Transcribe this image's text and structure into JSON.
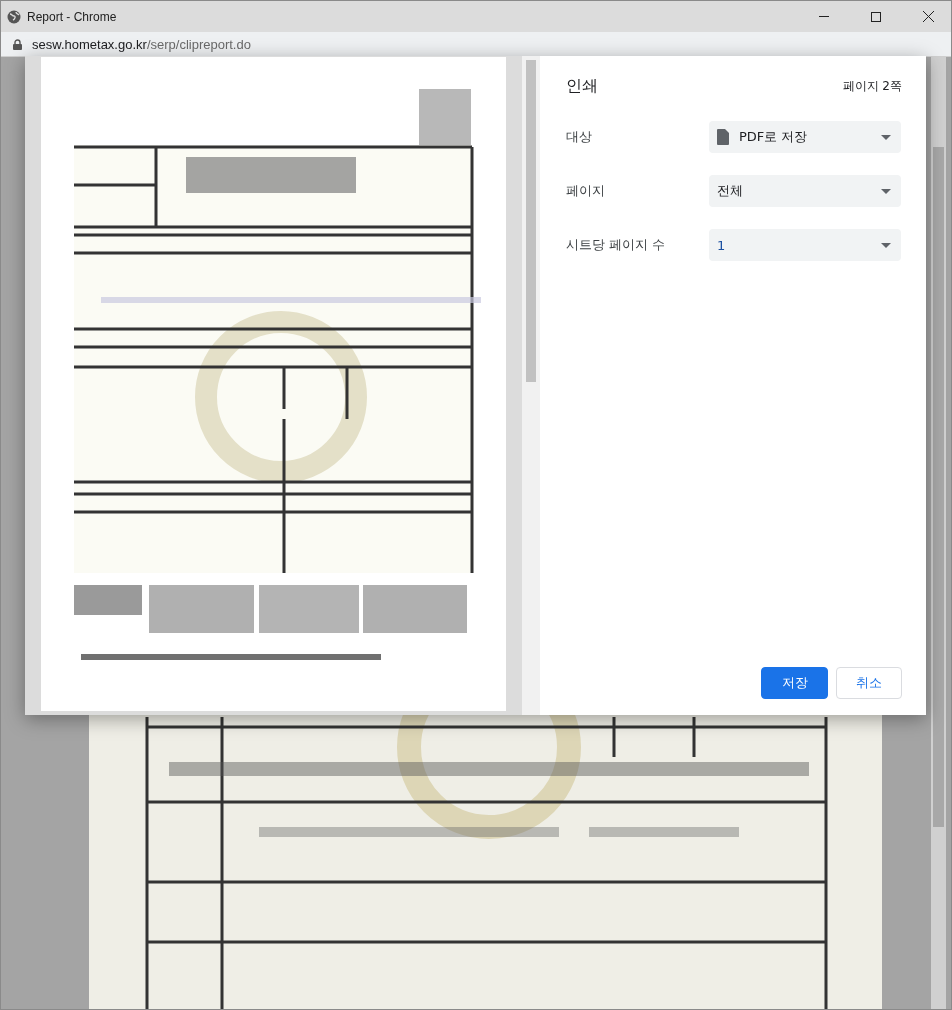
{
  "window": {
    "title": "Report - Chrome"
  },
  "address_bar": {
    "host": "sesw.hometax.go.kr",
    "path": "/serp/clipreport.do"
  },
  "print_dialog": {
    "title": "인쇄",
    "page_count": "페이지 2쪽",
    "settings": [
      {
        "label": "대상",
        "value": "PDF로 저장",
        "kind": "destination"
      },
      {
        "label": "페이지",
        "value": "전체",
        "kind": "select"
      },
      {
        "label": "시트당 페이지 수",
        "value": "1",
        "kind": "select"
      }
    ],
    "buttons": [
      {
        "label": "저장",
        "kind": "primary"
      },
      {
        "label": "취소",
        "kind": "secondary"
      }
    ]
  }
}
